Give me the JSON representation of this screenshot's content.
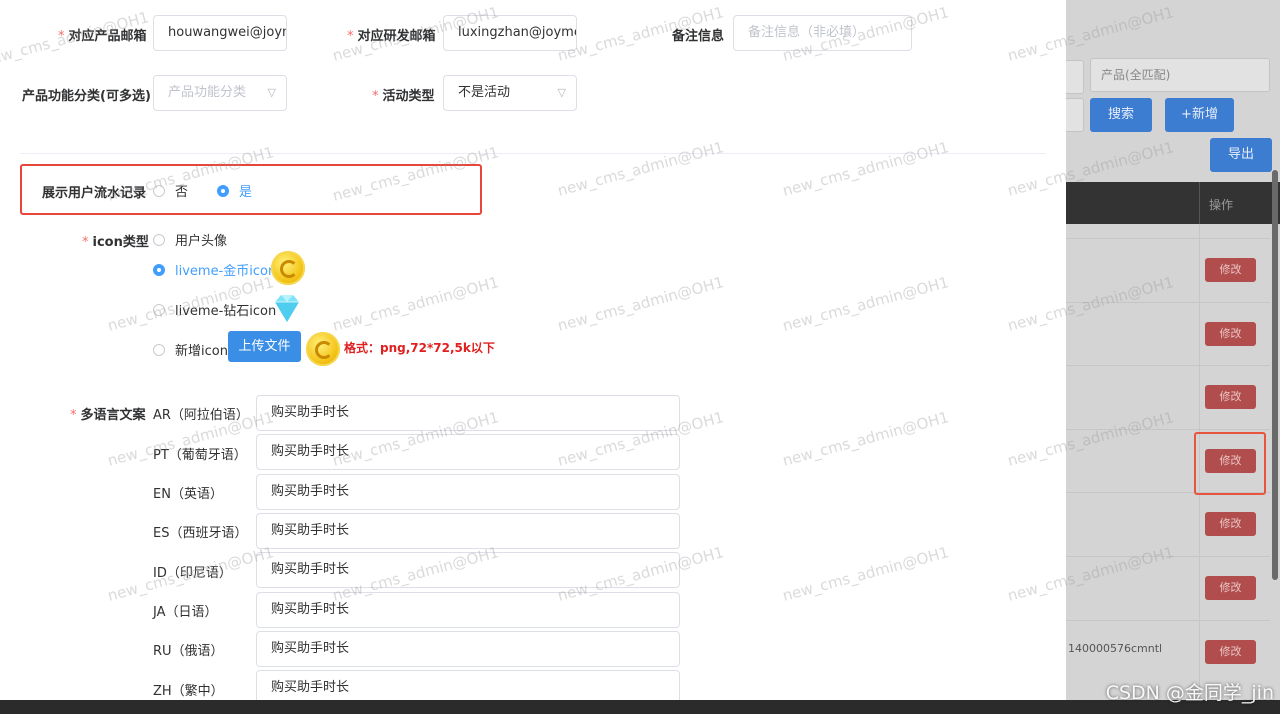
{
  "form": {
    "product_email": {
      "label": "对应产品邮箱",
      "value": "houwangwei@joym"
    },
    "rd_email": {
      "label": "对应研发邮箱",
      "value": "luxingzhan@joyme."
    },
    "remark": {
      "label": "备注信息",
      "placeholder": "备注信息（非必填）"
    },
    "feature_category": {
      "label": "产品功能分类(可多选)",
      "placeholder": "产品功能分类"
    },
    "activity_type": {
      "label": "活动类型",
      "value": "不是活动"
    },
    "show_flow": {
      "label": "展示用户流水记录",
      "options": [
        "否",
        "是"
      ],
      "selected": "是"
    },
    "icon_type": {
      "label": "icon类型",
      "options": [
        "用户头像",
        "liveme-金币icon",
        "liveme-钻石icon",
        "新增icon"
      ],
      "selected": "liveme-金币icon",
      "upload_label": "上传文件",
      "format_note": "格式：png,72*72,5k以下"
    },
    "multi_lang": {
      "label": "多语言文案",
      "rows": [
        {
          "lang": "AR（阿拉伯语）",
          "value": "购买助手时长"
        },
        {
          "lang": "PT（葡萄牙语）",
          "value": "购买助手时长"
        },
        {
          "lang": "EN（英语）",
          "value": "购买助手时长"
        },
        {
          "lang": "ES（西班牙语）",
          "value": "购买助手时长"
        },
        {
          "lang": "ID（印尼语）",
          "value": "购买助手时长"
        },
        {
          "lang": "JA（日语）",
          "value": "购买助手时长"
        },
        {
          "lang": "RU（俄语）",
          "value": "购买助手时长"
        },
        {
          "lang": "ZH（繁中）",
          "value": "购买助手时长"
        }
      ]
    }
  },
  "background_page": {
    "product_filter_placeholder": "产品(全匹配)",
    "search_label": "搜索",
    "add_label": "+新增",
    "export_label": "导出",
    "ops_header": "操作",
    "edit_label": "修改",
    "row_cut_text": "140000576cmntl"
  },
  "watermark": "new_cms_admin@OH1",
  "csdn_watermark": "CSDN @金同学_jin",
  "colors": {
    "primary": "#409eff",
    "danger": "#f56c6c",
    "highlight": "#e8463a"
  }
}
